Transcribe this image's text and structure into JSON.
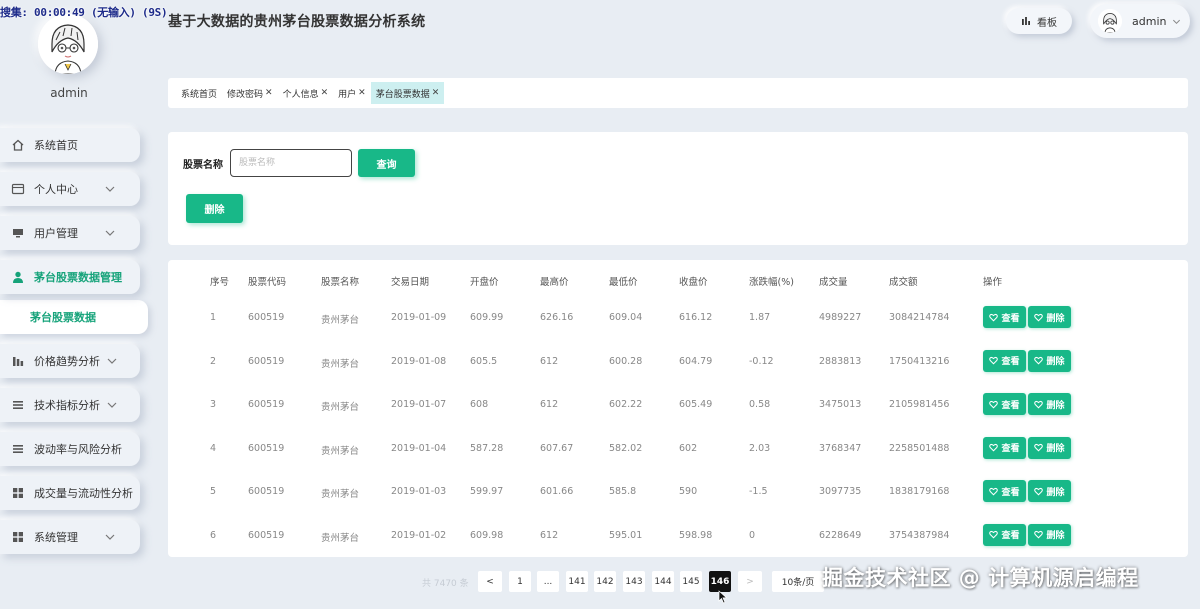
{
  "recording": {
    "overlay_text": "搜集: 00:00:49 (无输入) (9S)"
  },
  "app": {
    "title": "基于大数据的贵州茅台股票数据分析系统"
  },
  "sidebar": {
    "username": "admin",
    "menu": [
      {
        "label": "系统首页",
        "icon": "home-icon",
        "expandable": false
      },
      {
        "label": "个人中心",
        "icon": "id-card-icon",
        "expandable": true
      },
      {
        "label": "用户管理",
        "icon": "monitor-icon",
        "expandable": true
      },
      {
        "label": "茅台股票数据管理",
        "icon": "user-icon",
        "expandable": false,
        "active": true
      },
      {
        "label": "价格趋势分析",
        "icon": "bar-chart-icon",
        "expandable": true
      },
      {
        "label": "技术指标分析",
        "icon": "list-icon",
        "expandable": true
      },
      {
        "label": "波动率与风险分析",
        "icon": "list-icon",
        "expandable": false
      },
      {
        "label": "成交量与流动性分析",
        "icon": "grid-icon",
        "expandable": false
      },
      {
        "label": "系统管理",
        "icon": "grid-icon",
        "expandable": true
      }
    ],
    "submenu_active": "茅台股票数据"
  },
  "header": {
    "board_label": "看板",
    "user_label": "admin"
  },
  "tabs": [
    {
      "label": "系统首页",
      "closable": false
    },
    {
      "label": "修改密码",
      "closable": true
    },
    {
      "label": "个人信息",
      "closable": true
    },
    {
      "label": "用户",
      "closable": true
    },
    {
      "label": "茅台股票数据",
      "closable": true,
      "active": true
    }
  ],
  "search": {
    "label": "股票名称",
    "placeholder": "股票名称",
    "value": "",
    "query_label": "查询",
    "delete_label": "删除"
  },
  "table": {
    "columns": [
      "序号",
      "股票代码",
      "股票名称",
      "交易日期",
      "开盘价",
      "最高价",
      "最低价",
      "收盘价",
      "涨跌幅(%)",
      "成交量",
      "成交额",
      "操作"
    ],
    "rows": [
      [
        "1",
        "600519",
        "贵州茅台",
        "2019-01-09",
        "609.99",
        "626.16",
        "609.04",
        "616.12",
        "1.87",
        "4989227",
        "3084214784"
      ],
      [
        "2",
        "600519",
        "贵州茅台",
        "2019-01-08",
        "605.5",
        "612",
        "600.28",
        "604.79",
        "-0.12",
        "2883813",
        "1750413216"
      ],
      [
        "3",
        "600519",
        "贵州茅台",
        "2019-01-07",
        "608",
        "612",
        "602.22",
        "605.49",
        "0.58",
        "3475013",
        "2105981456"
      ],
      [
        "4",
        "600519",
        "贵州茅台",
        "2019-01-04",
        "587.28",
        "607.67",
        "582.02",
        "602",
        "2.03",
        "3768347",
        "2258501488"
      ],
      [
        "5",
        "600519",
        "贵州茅台",
        "2019-01-03",
        "599.97",
        "601.66",
        "585.8",
        "590",
        "-1.5",
        "3097735",
        "1838179168"
      ],
      [
        "6",
        "600519",
        "贵州茅台",
        "2019-01-02",
        "609.98",
        "612",
        "595.01",
        "598.98",
        "0",
        "6228649",
        "3754387984"
      ]
    ],
    "view_label": "查看",
    "delete_label": "删除"
  },
  "pagination": {
    "total_text": "共 7470 条",
    "prev": "<",
    "next": ">",
    "pages": [
      "1",
      "...",
      "141",
      "142",
      "143",
      "144",
      "145",
      "146"
    ],
    "current": "146",
    "page_size": "10条/页"
  },
  "watermark": "掘金技术社区 @ 计算机源启编程",
  "colors": {
    "accent": "#18b888",
    "background": "#e8edf3"
  }
}
